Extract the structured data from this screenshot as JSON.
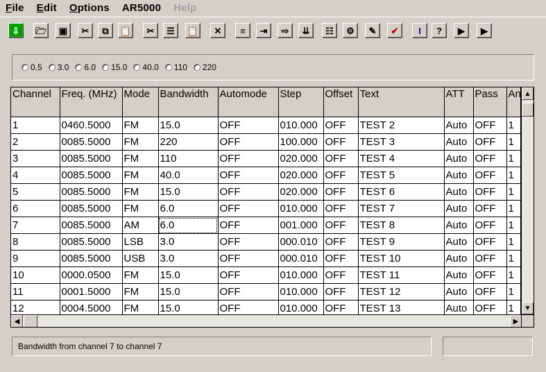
{
  "menu": [
    {
      "label": "File",
      "underline": "F",
      "rest": "ile",
      "disabled": false
    },
    {
      "label": "Edit",
      "underline": "E",
      "rest": "dit",
      "disabled": false
    },
    {
      "label": "Options",
      "underline": "O",
      "rest": "ptions",
      "disabled": false
    },
    {
      "label": "AR5000",
      "underline": "",
      "rest": "AR5000",
      "disabled": false
    },
    {
      "label": "Help",
      "underline": "",
      "rest": "Help",
      "disabled": true
    }
  ],
  "toolbar": {
    "buttons": [
      {
        "name": "download-icon",
        "glyph": "⇩"
      },
      {
        "name": "open-folder-icon",
        "glyph": "🗁"
      },
      {
        "name": "save-disk-icon",
        "glyph": "▣"
      },
      {
        "name": "cut-icon",
        "glyph": "✂"
      },
      {
        "name": "copy-icon",
        "glyph": "⧉"
      },
      {
        "name": "paste-icon",
        "glyph": "📋"
      },
      {
        "name": "cut-rows-icon",
        "glyph": "✂"
      },
      {
        "name": "copy-rows-icon",
        "glyph": "☰"
      },
      {
        "name": "paste-rows-icon",
        "glyph": "📋"
      },
      {
        "name": "delete-icon",
        "glyph": "✕"
      },
      {
        "name": "insert-rows-icon",
        "glyph": "≡"
      },
      {
        "name": "fill-right-icon",
        "glyph": "⇥"
      },
      {
        "name": "fill-down-arrow-icon",
        "glyph": "⇨"
      },
      {
        "name": "sort-icon",
        "glyph": "⇊"
      },
      {
        "name": "list-icon",
        "glyph": "☷"
      },
      {
        "name": "radio-scan-icon",
        "glyph": "⚙"
      },
      {
        "name": "edit-pencil-icon",
        "glyph": "✎"
      },
      {
        "name": "check-icon",
        "glyph": "✔"
      },
      {
        "name": "info-icon",
        "glyph": "I"
      },
      {
        "name": "help-icon",
        "glyph": "?"
      },
      {
        "name": "send-icon",
        "glyph": "▶"
      },
      {
        "name": "receive-icon",
        "glyph": "▶"
      }
    ]
  },
  "bandwidth_options": [
    {
      "label": "0.5"
    },
    {
      "label": "3.0"
    },
    {
      "label": "6.0"
    },
    {
      "label": "15.0"
    },
    {
      "label": "40.0"
    },
    {
      "label": "110"
    },
    {
      "label": "220"
    }
  ],
  "table": {
    "headers": [
      "Channel",
      "Freq. (MHz)",
      "Mode",
      "Bandwidth",
      "Automode",
      "Step",
      "Offset",
      "Text",
      "ATT",
      "Pass",
      "An"
    ],
    "rows": [
      [
        "1",
        "0460.5000",
        "FM",
        "15.0",
        "OFF",
        "010.000",
        "OFF",
        "TEST 2",
        "Auto",
        "OFF",
        "1"
      ],
      [
        "2",
        "0085.5000",
        "FM",
        "220",
        "OFF",
        "100.000",
        "OFF",
        "TEST 3",
        "Auto",
        "OFF",
        "1"
      ],
      [
        "3",
        "0085.5000",
        "FM",
        "110",
        "OFF",
        "020.000",
        "OFF",
        "TEST 4",
        "Auto",
        "OFF",
        "1"
      ],
      [
        "4",
        "0085.5000",
        "FM",
        "40.0",
        "OFF",
        "020.000",
        "OFF",
        "TEST 5",
        "Auto",
        "OFF",
        "1"
      ],
      [
        "5",
        "0085.5000",
        "FM",
        "15.0",
        "OFF",
        "020.000",
        "OFF",
        "TEST 6",
        "Auto",
        "OFF",
        "1"
      ],
      [
        "6",
        "0085.5000",
        "FM",
        "6.0",
        "OFF",
        "010.000",
        "OFF",
        "TEST 7",
        "Auto",
        "OFF",
        "1"
      ],
      [
        "7",
        "0085.5000",
        "AM",
        "6.0",
        "OFF",
        "001.000",
        "OFF",
        "TEST 8",
        "Auto",
        "OFF",
        "1"
      ],
      [
        "8",
        "0085.5000",
        "LSB",
        "3.0",
        "OFF",
        "000.010",
        "OFF",
        "TEST 9",
        "Auto",
        "OFF",
        "1"
      ],
      [
        "9",
        "0085.5000",
        "USB",
        "3.0",
        "OFF",
        "000.010",
        "OFF",
        "TEST 10",
        "Auto",
        "OFF",
        "1"
      ],
      [
        "10",
        "0000.0500",
        "FM",
        "15.0",
        "OFF",
        "010.000",
        "OFF",
        "TEST 11",
        "Auto",
        "OFF",
        "1"
      ],
      [
        "11",
        "0001.5000",
        "FM",
        "15.0",
        "OFF",
        "010.000",
        "OFF",
        "TEST 12",
        "Auto",
        "OFF",
        "1"
      ],
      [
        "12",
        "0004.5000",
        "FM",
        "15.0",
        "OFF",
        "010.000",
        "OFF",
        "TEST 13",
        "Auto",
        "OFF",
        "1"
      ]
    ]
  },
  "status": {
    "message": "Bandwidth from channel  7 to channel  7",
    "secondary": ""
  },
  "colors": {
    "chrome": "#d4d0c8",
    "first_button": "#00a000",
    "check_icon": "#c00000",
    "info_icon": "#0000c0"
  }
}
